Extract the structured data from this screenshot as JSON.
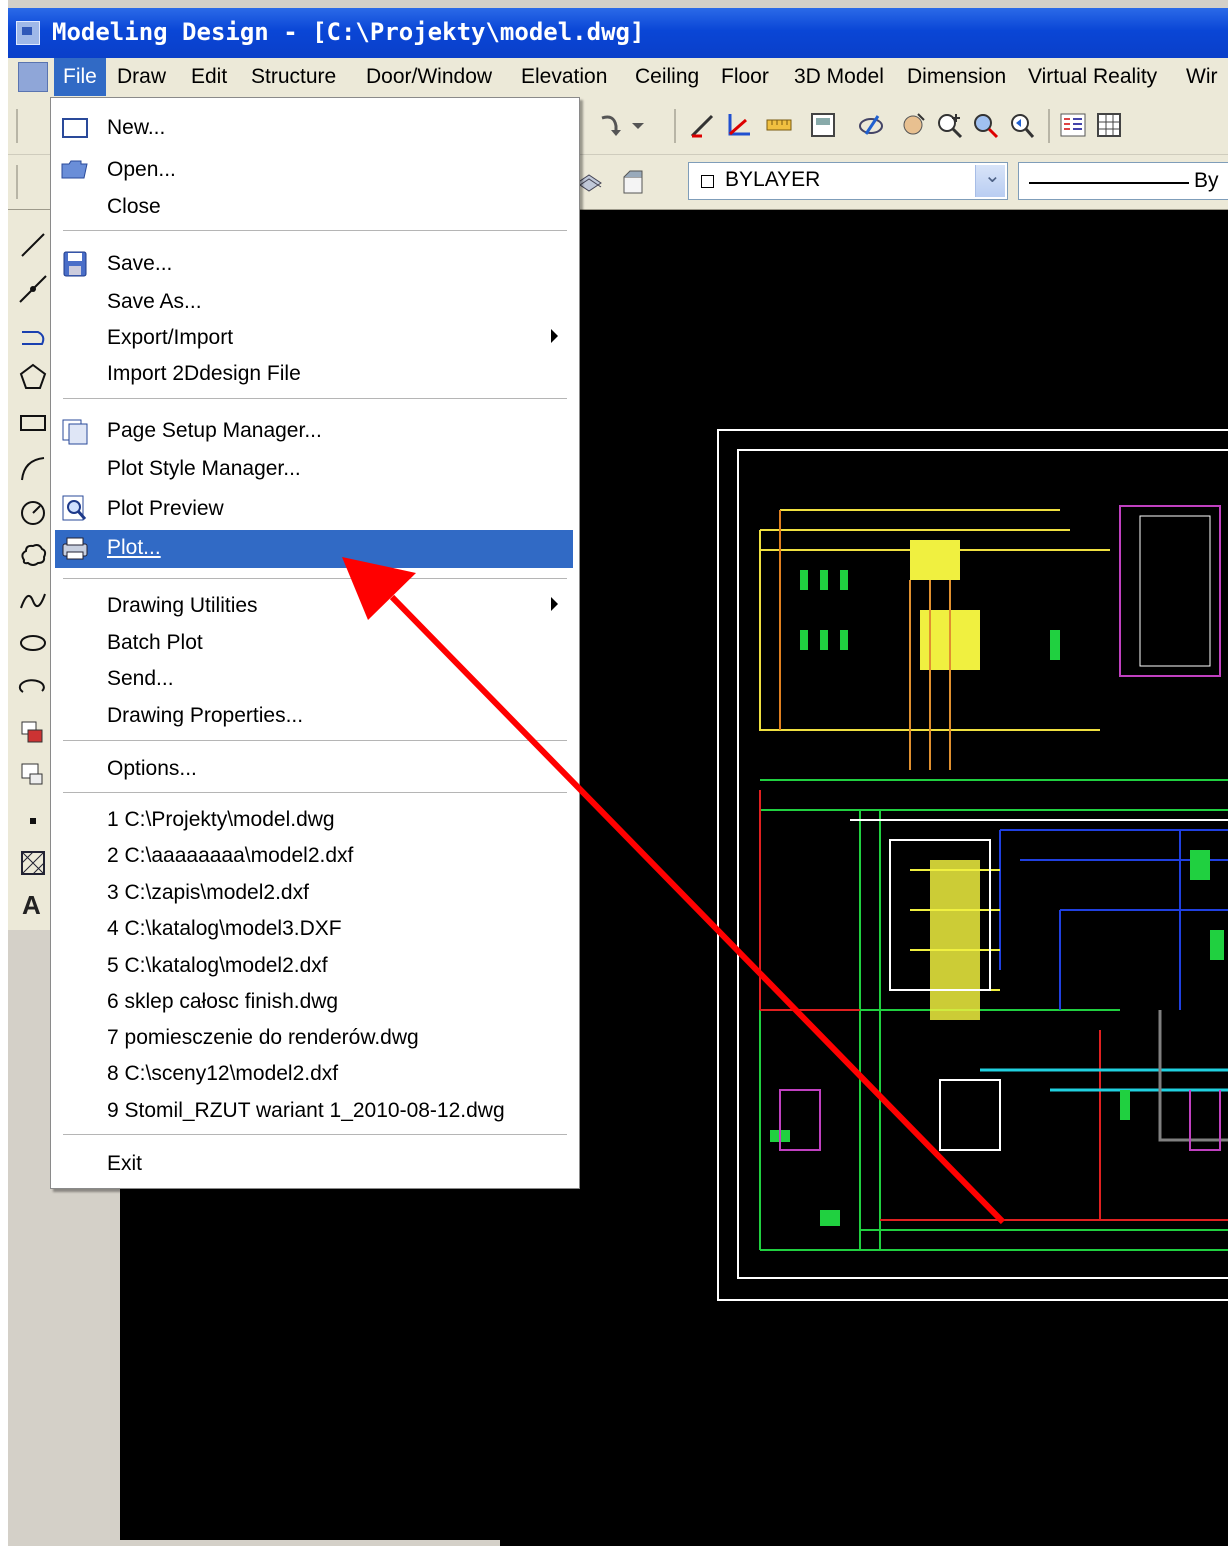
{
  "window": {
    "title": "Modeling Design - [C:\\Projekty\\model.dwg]"
  },
  "menubar": {
    "items": [
      "File",
      "Draw",
      "Edit",
      "Structure",
      "Door/Window",
      "Elevation",
      "Ceiling",
      "Floor",
      "3D Model",
      "Dimension",
      "Virtual Reality",
      "Wir"
    ],
    "active": "File"
  },
  "properties": {
    "color": "BYLAYER",
    "linetype": "By"
  },
  "file_menu": {
    "items": [
      {
        "label": "New...",
        "icon": "new-file-icon"
      },
      {
        "label": "Open...",
        "icon": "open-folder-icon"
      },
      {
        "label": "Close"
      },
      {
        "label": "Save...",
        "icon": "floppy-disk-icon"
      },
      {
        "label": "Save As..."
      },
      {
        "label": "Export/Import",
        "submenu": true
      },
      {
        "label": "Import 2Ddesign File"
      },
      {
        "label": "Page Setup Manager...",
        "icon": "page-setup-icon"
      },
      {
        "label": "Plot Style Manager..."
      },
      {
        "label": "Plot Preview",
        "icon": "plot-preview-icon"
      },
      {
        "label": "Plot...",
        "icon": "printer-icon",
        "highlighted": true
      },
      {
        "label": "Drawing Utilities",
        "submenu": true
      },
      {
        "label": "Batch Plot"
      },
      {
        "label": "Send..."
      },
      {
        "label": "Drawing Properties..."
      },
      {
        "label": "Options..."
      },
      {
        "label": "1 C:\\Projekty\\model.dwg"
      },
      {
        "label": "2 C:\\aaaaaaaa\\model2.dxf"
      },
      {
        "label": "3 C:\\zapis\\model2.dxf"
      },
      {
        "label": "4 C:\\katalog\\model3.DXF"
      },
      {
        "label": "5 C:\\katalog\\model2.dxf"
      },
      {
        "label": "6 sklep całosc finish.dwg"
      },
      {
        "label": "7 pomiesczenie do renderów.dwg"
      },
      {
        "label": "8 C:\\sceny12\\model2.dxf"
      },
      {
        "label": "9 Stomil_RZUT wariant 1_2010-08-12.dwg"
      },
      {
        "label": "Exit"
      }
    ]
  },
  "palette": {
    "text_tool": "A"
  },
  "colors": {
    "title_bar": "#0a46d6",
    "menu_highlight": "#316ac5",
    "annotation_arrow": "#ff0000",
    "canvas": "#000000"
  }
}
